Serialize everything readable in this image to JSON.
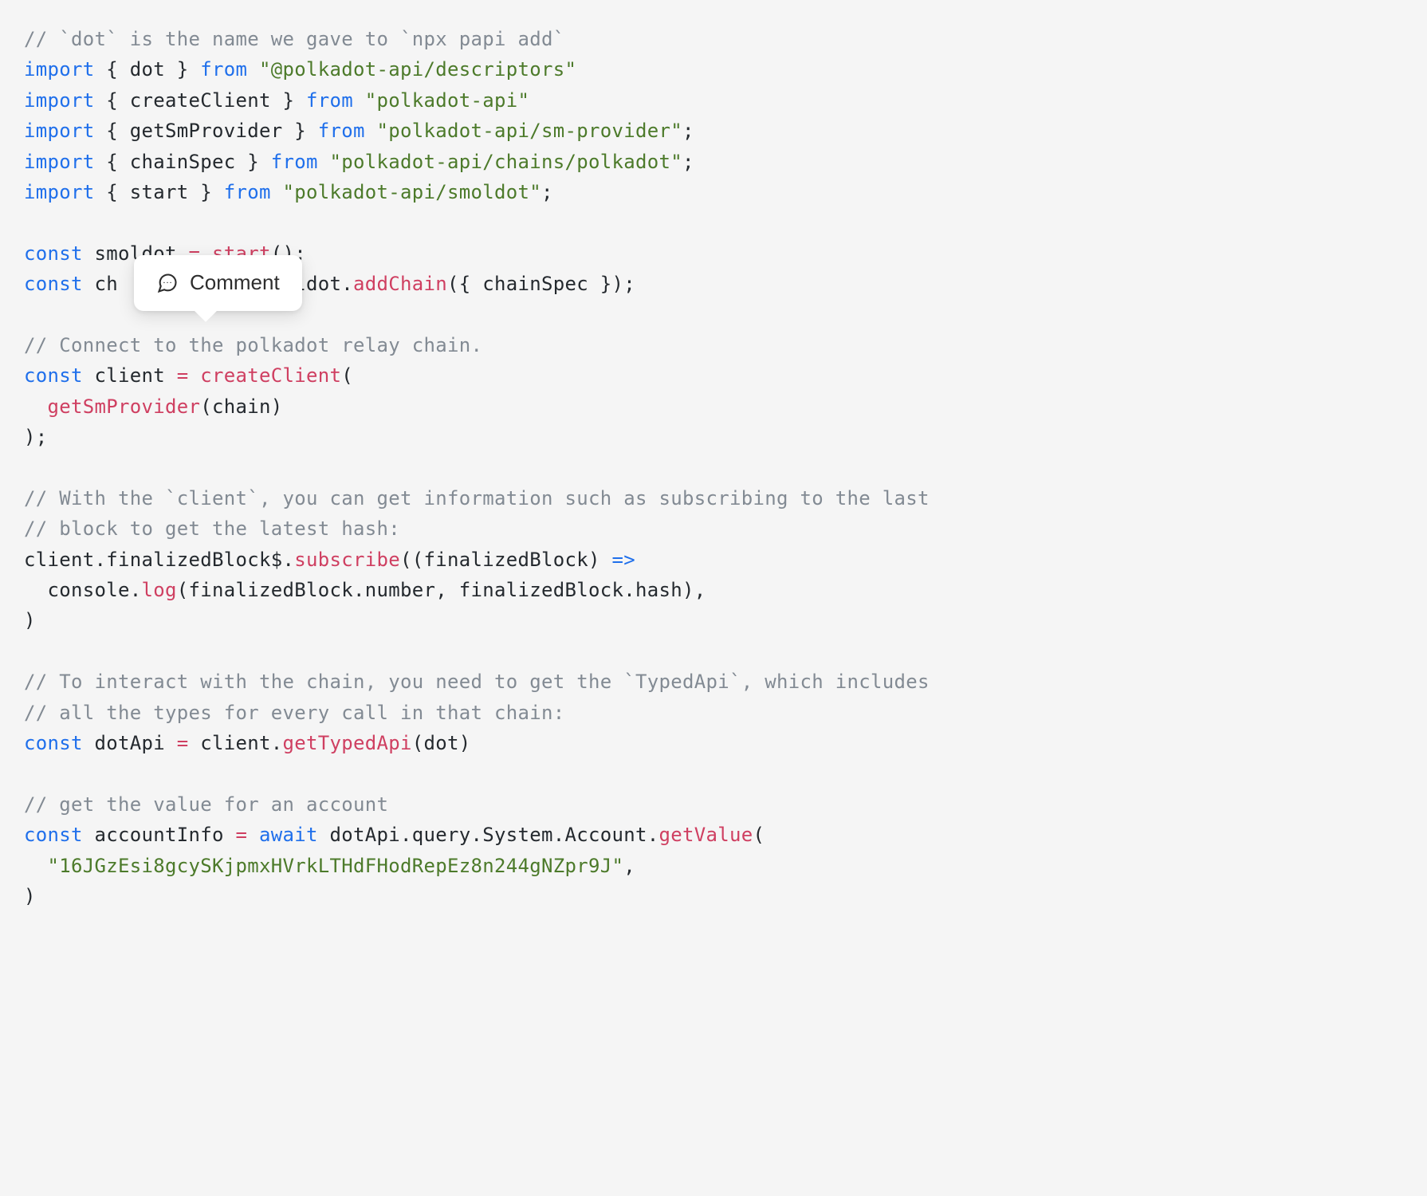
{
  "tooltip": {
    "label": "Comment"
  },
  "code": {
    "c1": "// `dot` is the name we gave to `npx papi add`",
    "kw_import": "import",
    "kw_from": "from",
    "kw_const": "const",
    "kw_await": "await",
    "imp1_sym": "dot",
    "imp1_mod": "\"@polkadot-api/descriptors\"",
    "imp2_sym": "createClient",
    "imp2_mod": "\"polkadot-api\"",
    "imp3_sym": "getSmProvider",
    "imp3_mod": "\"polkadot-api/sm-provider\"",
    "imp4_sym": "chainSpec",
    "imp4_mod": "\"polkadot-api/chains/polkadot\"",
    "imp5_sym": "start",
    "imp5_mod": "\"polkadot-api/smoldot\"",
    "v_smoldot": "smoldot",
    "fn_start": "start",
    "v_ch": "ch",
    "v_moldot": "moldot",
    "fn_addChain": "addChain",
    "v_chainSpec": "chainSpec",
    "c2": "// Connect to the polkadot relay chain.",
    "v_client": "client",
    "fn_createClient": "createClient",
    "fn_getSmProvider": "getSmProvider",
    "v_chain": "chain",
    "c3a": "// With the `client`, you can get information such as subscribing to the last",
    "c3b": "// block to get the latest hash:",
    "p_finalizedBlock$": "finalizedBlock$",
    "fn_subscribe": "subscribe",
    "v_finalizedBlock": "finalizedBlock",
    "p_console": "console",
    "fn_log": "log",
    "p_number": "number",
    "p_hash": "hash",
    "c4a": "// To interact with the chain, you need to get the `TypedApi`, which includes",
    "c4b": "// all the types for every call in that chain:",
    "v_dotApi": "dotApi",
    "fn_getTypedApi": "getTypedApi",
    "v_dot": "dot",
    "c5": "// get the value for an account",
    "v_accountInfo": "accountInfo",
    "p_query": "query",
    "p_System": "System",
    "p_Account": "Account",
    "fn_getValue": "getValue",
    "str_account": "\"16JGzEsi8gcySKjpmxHVrkLTHdFHodRepEz8n244gNZpr9J\""
  }
}
